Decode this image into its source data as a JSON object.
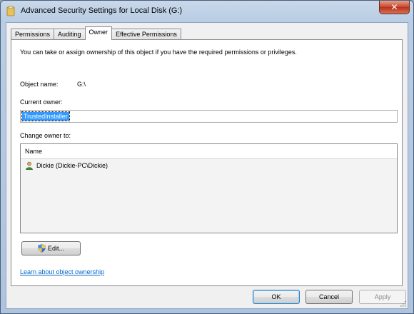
{
  "window": {
    "title": "Advanced Security Settings for Local Disk (G:)",
    "close_glyph": "✕"
  },
  "tabs": [
    {
      "label": "Permissions"
    },
    {
      "label": "Auditing"
    },
    {
      "label": "Owner",
      "active": true
    },
    {
      "label": "Effective Permissions"
    }
  ],
  "owner_tab": {
    "intro": "You can take or assign ownership of this object if you have the required permissions or privileges.",
    "object_name_label": "Object name:",
    "object_name_value": "G:\\",
    "current_owner_label": "Current owner:",
    "current_owner_value": "TrustedInstaller",
    "change_owner_label": "Change owner to:",
    "list_header": "Name",
    "list_items": [
      {
        "name": "Dickie (Dickie-PC\\Dickie)",
        "icon": "user-icon"
      }
    ],
    "edit_button": "Edit...",
    "learn_link": "Learn about object ownership"
  },
  "buttons": {
    "ok": "OK",
    "cancel": "Cancel",
    "apply": "Apply"
  },
  "colors": {
    "selection": "#3399ff",
    "link": "#0066cc",
    "close_button": "#c8452a"
  }
}
